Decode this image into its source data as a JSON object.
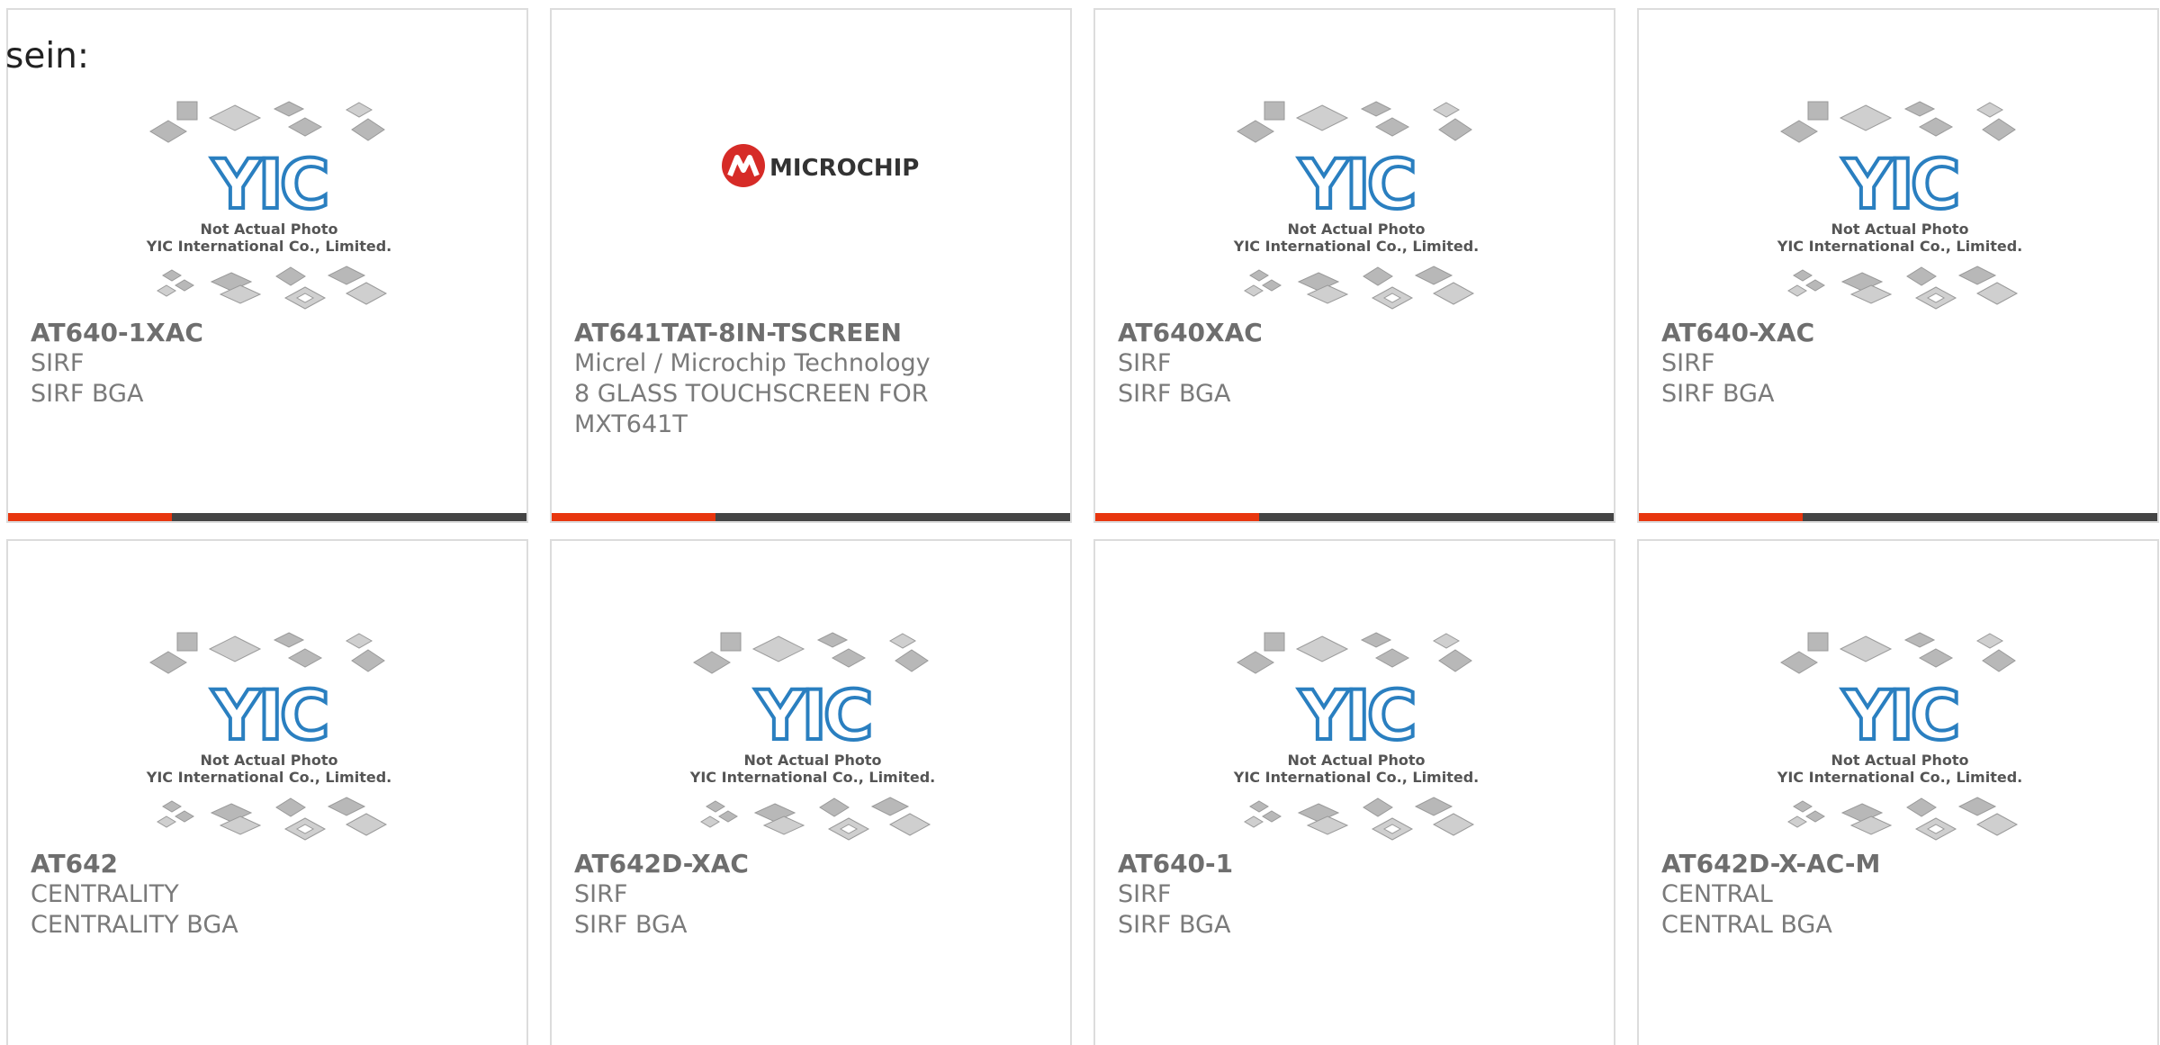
{
  "intro_text": "sein:",
  "theme": {
    "accent": "#e8360e",
    "bar_dark": "#444444",
    "card_border": "#dcdcdc",
    "text_gray": "#7a7a7a",
    "yic_blue": "#2a7fc0"
  },
  "placeholder": {
    "line1": "Not Actual Photo",
    "line2": "YIC International Co., Limited.",
    "logo_text": "YIC"
  },
  "microchip_logo_text": "MICROCHIP",
  "products": [
    {
      "part": "AT640-1XAC",
      "manufacturer": "SIRF",
      "description": "SIRF BGA",
      "image": "yic-placeholder"
    },
    {
      "part": "AT641TAT-8IN-TSCREEN",
      "manufacturer": "Micrel / Microchip Technology",
      "description": "8 GLASS TOUCHSCREEN FOR MXT641T",
      "image": "microchip-logo"
    },
    {
      "part": "AT640XAC",
      "manufacturer": "SIRF",
      "description": "SIRF BGA",
      "image": "yic-placeholder"
    },
    {
      "part": "AT640-XAC",
      "manufacturer": "SIRF",
      "description": "SIRF BGA",
      "image": "yic-placeholder"
    },
    {
      "part": "AT642",
      "manufacturer": "CENTRALITY",
      "description": "CENTRALITY BGA",
      "image": "yic-placeholder"
    },
    {
      "part": "AT642D-XAC",
      "manufacturer": "SIRF",
      "description": "SIRF BGA",
      "image": "yic-placeholder"
    },
    {
      "part": "AT640-1",
      "manufacturer": "SIRF",
      "description": "SIRF BGA",
      "image": "yic-placeholder"
    },
    {
      "part": "AT642D-X-AC-M",
      "manufacturer": "CENTRAL",
      "description": "CENTRAL BGA",
      "image": "yic-placeholder"
    }
  ]
}
